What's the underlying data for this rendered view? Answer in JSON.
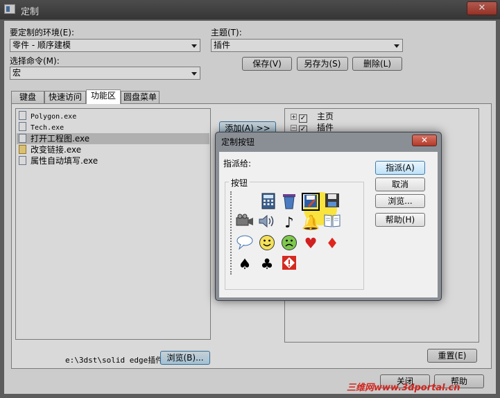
{
  "window": {
    "title": "定制",
    "close_glyph": "✕"
  },
  "form": {
    "env_label": "要定制的环境(E):",
    "env_value": "零件 - 顺序建模",
    "theme_label": "主题(T):",
    "theme_value": "插件",
    "cmd_label": "选择命令(M):",
    "cmd_value": "宏",
    "save_btn": "保存(V)",
    "saveas_btn": "另存为(S)",
    "delete_btn": "删除(L)"
  },
  "tabs": [
    "键盘",
    "快速访问",
    "功能区",
    "圆盘菜单"
  ],
  "active_tab": "功能区",
  "commands": [
    {
      "name": "Polygon.exe",
      "mono": true,
      "icon": "file-icon"
    },
    {
      "name": "Tech.exe",
      "mono": true,
      "icon": "file-icon"
    },
    {
      "name": "打开工程图.exe",
      "mono": false,
      "icon": "file-icon",
      "selected": true
    },
    {
      "name": "改变链接.exe",
      "mono": false,
      "icon": "link-file-icon"
    },
    {
      "name": "属性自动填写.exe",
      "mono": false,
      "icon": "file-icon"
    }
  ],
  "add_btn": "添加(A) >>",
  "tree": [
    {
      "label": "主页",
      "checked": true,
      "expander": "+"
    },
    {
      "label": "插件",
      "checked": true,
      "expander": "−"
    }
  ],
  "path_text": "e:\\3dst\\solid edge插件",
  "browse_btn": "浏览(B)...",
  "reset_btn": "重置(E)",
  "close_btn": "关闭",
  "help_btn": "帮助",
  "watermark": "三维网www.3dportal.cn",
  "dialog": {
    "title": "定制按钮",
    "assign_label": "指派给:",
    "group_label": "按钮",
    "assign_btn": "指派(A)",
    "cancel_btn": "取消",
    "browse_btn": "浏览...",
    "help_btn": "帮助(H)",
    "icons": [
      [
        "calculator-icon",
        "trash-can-icon",
        "save-edit-icon",
        "save-disk-icon"
      ],
      [
        "video-camera-icon",
        "speaker-icon",
        "music-note-icon",
        "bell-icon",
        "book-icon"
      ],
      [
        "speech-bubble-icon",
        "smiley-face-icon",
        "sad-face-icon",
        "heart-icon",
        "diamond-icon"
      ],
      [
        "spade-icon",
        "club-icon",
        "warning-sign-icon"
      ]
    ]
  }
}
